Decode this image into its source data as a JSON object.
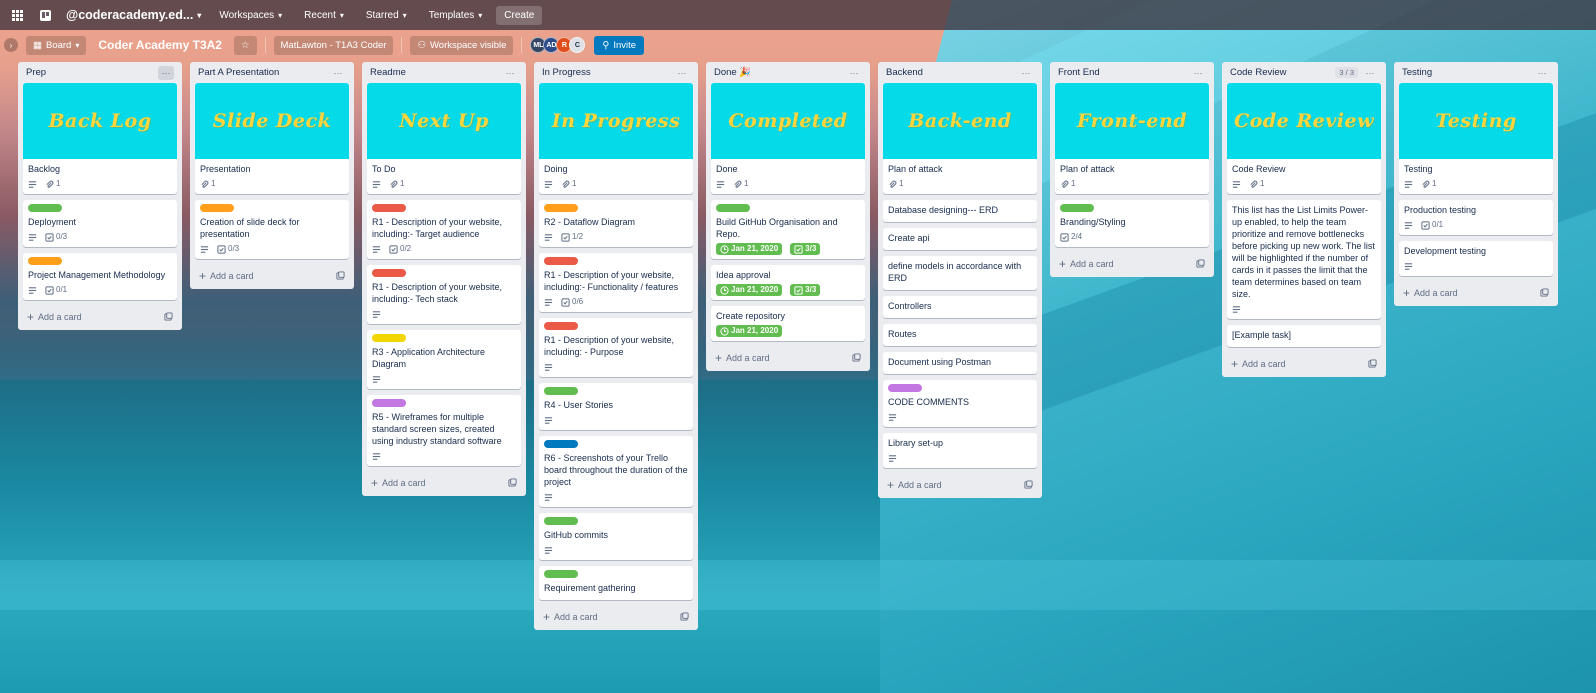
{
  "colors": {
    "green": "#61bd4f",
    "orange": "#ff9f1a",
    "red": "#eb5a46",
    "yellow": "#f2d600",
    "purple": "#c377e0",
    "blue": "#0079bf",
    "cover": "#05dbe8",
    "cover_text": "#ffd53b"
  },
  "topbar": {
    "apps_icon": "grid-icon",
    "logo_icon": "board-icon",
    "workspace": "@coderacademy.ed...",
    "menus": [
      "Workspaces",
      "Recent",
      "Starred",
      "Templates"
    ],
    "create": "Create"
  },
  "boardbar": {
    "view": "Board",
    "title": "Coder Academy T3A2",
    "workspace_name": "MatLawton - T1A3 Coder",
    "visibility": "Workspace visible",
    "members": [
      {
        "initials": "ML",
        "color": "#344563"
      },
      {
        "initials": "AD",
        "color": "#2d4a8a"
      },
      {
        "initials": "R",
        "color": "#e04e1c"
      },
      {
        "initials": "C",
        "color": "#dfe1e6"
      }
    ],
    "invite": "Invite"
  },
  "add_card_label": "Add a card",
  "lists": [
    {
      "title": "Prep",
      "menu_active": true,
      "cards": [
        {
          "cover": "Back Log",
          "title": "Backlog",
          "desc": true,
          "attachments": "1"
        },
        {
          "label": "green",
          "title": "Deployment",
          "desc": true,
          "checklist": "0/3"
        },
        {
          "label": "orange",
          "title": "Project Management Methodology",
          "desc": true,
          "checklist": "0/1"
        }
      ]
    },
    {
      "title": "Part A Presentation",
      "cards": [
        {
          "cover": "Slide Deck",
          "title": "Presentation",
          "attachments": "1"
        },
        {
          "label": "orange",
          "title": "Creation of slide deck for presentation",
          "desc": true,
          "checklist": "0/3"
        }
      ]
    },
    {
      "title": "Readme",
      "cards": [
        {
          "cover": "Next Up",
          "title": "To Do",
          "desc": true,
          "attachments": "1"
        },
        {
          "label": "red",
          "title": "R1 - Description of your website, including:- Target audience",
          "desc": true,
          "checklist": "0/2"
        },
        {
          "label": "red",
          "title": "R1 - Description of your website, including:- Tech stack",
          "desc": true
        },
        {
          "label": "yellow",
          "title": "R3 - Application Architecture Diagram",
          "desc": true
        },
        {
          "label": "purple",
          "title": "R5 - Wireframes for multiple standard screen sizes, created using industry standard software",
          "desc": true
        }
      ]
    },
    {
      "title": "In Progress",
      "cards": [
        {
          "cover": "In Progress",
          "title": "Doing",
          "desc": true,
          "attachments": "1"
        },
        {
          "label": "orange",
          "title": "R2 - Dataflow Diagram",
          "desc": true,
          "checklist": "1/2"
        },
        {
          "label": "red",
          "title": "R1 - Description of your website, including:- Functionality / features",
          "desc": true,
          "checklist": "0/6"
        },
        {
          "label": "red",
          "title": "R1 - Description of your website, including: - Purpose",
          "desc": true
        },
        {
          "label": "green",
          "title": "R4 - User Stories",
          "desc": true
        },
        {
          "label": "blue",
          "title": "R6 - Screenshots of your Trello board throughout the duration of the project",
          "desc": true
        },
        {
          "label": "green",
          "title": "GitHub commits",
          "desc": true
        },
        {
          "label": "green",
          "title": "Requirement gathering"
        }
      ]
    },
    {
      "title": "Done 🎉",
      "cards": [
        {
          "cover": "Completed",
          "title": "Done",
          "desc": true,
          "attachments": "1"
        },
        {
          "label": "green",
          "title": "Build GitHub Organisation and Repo.",
          "due": "Jan 21, 2020",
          "checklist_done": "3/3"
        },
        {
          "title": "Idea approval",
          "due": "Jan 21, 2020",
          "checklist_done": "3/3"
        },
        {
          "title": "Create repository",
          "due": "Jan 21, 2020"
        }
      ]
    },
    {
      "title": "Backend",
      "cards": [
        {
          "cover": "Back-end",
          "title": "Plan of attack",
          "attachments": "1"
        },
        {
          "title": "Database designing--- ERD"
        },
        {
          "title": "Create api"
        },
        {
          "title": "define models in accordance with ERD"
        },
        {
          "title": "Controllers"
        },
        {
          "title": "Routes"
        },
        {
          "title": "Document using Postman"
        },
        {
          "label": "purple",
          "title": "CODE COMMENTS",
          "desc": true
        },
        {
          "title": "Library set-up",
          "desc": true
        }
      ]
    },
    {
      "title": "Front End",
      "cards": [
        {
          "cover": "Front-end",
          "title": "Plan of attack",
          "attachments": "1"
        },
        {
          "label": "green",
          "title": "Branding/Styling",
          "checklist": "2/4"
        }
      ]
    },
    {
      "title": "Code Review",
      "limit": "3 / 3",
      "cards": [
        {
          "cover": "Code Review",
          "title": "Code Review",
          "desc": true,
          "attachments": "1"
        },
        {
          "title": "This list has the List Limits Power-up enabled, to help the team prioritize and remove bottlenecks before picking up new work. The list will be highlighted if the number of cards in it passes the limit that the team determines based on team size.",
          "desc": true
        },
        {
          "title": "[Example task]"
        }
      ]
    },
    {
      "title": "Testing",
      "cards": [
        {
          "cover": "Testing",
          "title": "Testing",
          "desc": true,
          "attachments": "1"
        },
        {
          "title": "Production testing",
          "desc": true,
          "checklist": "0/1"
        },
        {
          "title": "Development testing",
          "desc": true
        }
      ]
    }
  ]
}
